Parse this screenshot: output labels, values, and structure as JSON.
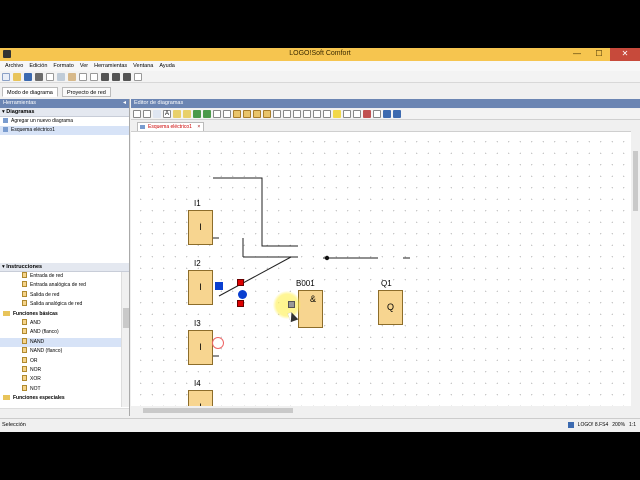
{
  "window": {
    "title": "LOGO!Soft Comfort",
    "minimize": "—",
    "maximize": "☐",
    "close": "✕"
  },
  "menu": [
    "Archivo",
    "Edición",
    "Formato",
    "Ver",
    "Herramientas",
    "Ventana",
    "Ayuda"
  ],
  "mode_tabs": [
    "Modo de diagrama",
    "Proyecto de red"
  ],
  "left_panel": {
    "title": "Herramientas",
    "diagrams_header": "Diagramas",
    "diagram_items": [
      "Agregar un nuevo diagrama",
      "Esquema eléctrico1"
    ],
    "instructions_header": "Instrucciones",
    "instructions": [
      {
        "label": "Entrada de red",
        "kind": "item"
      },
      {
        "label": "Entrada analógica de red",
        "kind": "item"
      },
      {
        "label": "Salida de red",
        "kind": "item"
      },
      {
        "label": "Salida analógica de red",
        "kind": "item"
      },
      {
        "label": "Funciones básicas",
        "kind": "folder"
      },
      {
        "label": "AND",
        "kind": "item"
      },
      {
        "label": "AND (flanco)",
        "kind": "item"
      },
      {
        "label": "NAND",
        "kind": "item",
        "selected": true
      },
      {
        "label": "NAND (flanco)",
        "kind": "item"
      },
      {
        "label": "OR",
        "kind": "item"
      },
      {
        "label": "NOR",
        "kind": "item"
      },
      {
        "label": "XOR",
        "kind": "item"
      },
      {
        "label": "NOT",
        "kind": "item"
      },
      {
        "label": "Funciones especiales",
        "kind": "folder"
      }
    ]
  },
  "editor": {
    "title": "Editor de diagramas",
    "doc_tab": "Esquema eléctrico1",
    "doc_tab_close": "×"
  },
  "diagram": {
    "inputs": [
      {
        "name": "I1",
        "symbol": "I"
      },
      {
        "name": "I2",
        "symbol": "I"
      },
      {
        "name": "I3",
        "symbol": "I"
      },
      {
        "name": "I4",
        "symbol": "I"
      }
    ],
    "and_block": {
      "name": "B001",
      "symbol": "&"
    },
    "output": {
      "name": "Q1",
      "symbol": "Q"
    }
  },
  "status": {
    "left": "Selección",
    "device": "LOGO! 8.FS4",
    "zoom": "200%",
    "page": "1:1"
  },
  "colors": {
    "title_bar": "#f6c54f",
    "panel_header": "#6b85b3",
    "block_fill": "#f7d590",
    "close_button": "#c74a3b"
  }
}
